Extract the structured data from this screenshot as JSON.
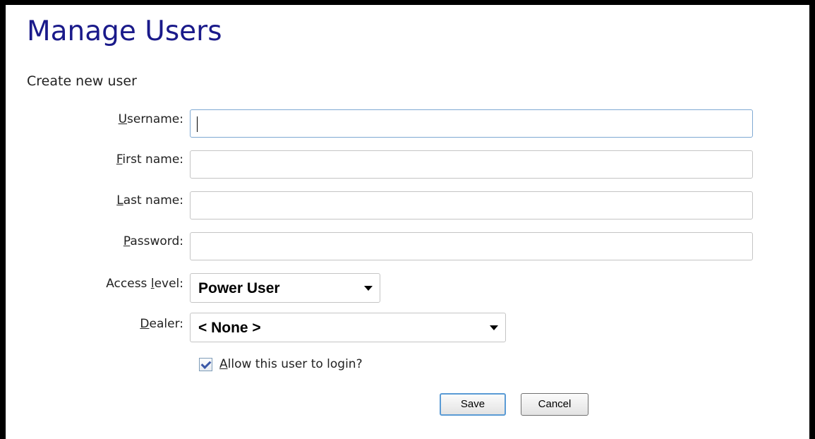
{
  "page": {
    "title": "Manage Users",
    "subtitle": "Create new user"
  },
  "form": {
    "username": {
      "access_key": "U",
      "rest": "sername:",
      "value": ""
    },
    "first_name": {
      "access_key": "F",
      "rest": "irst name:",
      "value": ""
    },
    "last_name": {
      "access_key": "L",
      "rest": "ast name:",
      "value": ""
    },
    "password": {
      "access_key": "P",
      "rest": "assword:",
      "value": ""
    },
    "access_level": {
      "prefix": "Access ",
      "access_key": "l",
      "rest": "evel:",
      "selected": "Power User"
    },
    "dealer": {
      "access_key": "D",
      "rest": "ealer:",
      "selected": "< None >"
    },
    "allow_login": {
      "access_key": "A",
      "rest": "llow this user to login?",
      "checked": true
    }
  },
  "buttons": {
    "save": "Save",
    "cancel": "Cancel"
  },
  "colors": {
    "title": "#1a1a8a",
    "focus_border": "#7fa9d3",
    "primary_button_border": "#5a9bd5"
  },
  "icons": {
    "dropdown": "chevron-down-icon",
    "checkbox": "checkmark-icon"
  }
}
